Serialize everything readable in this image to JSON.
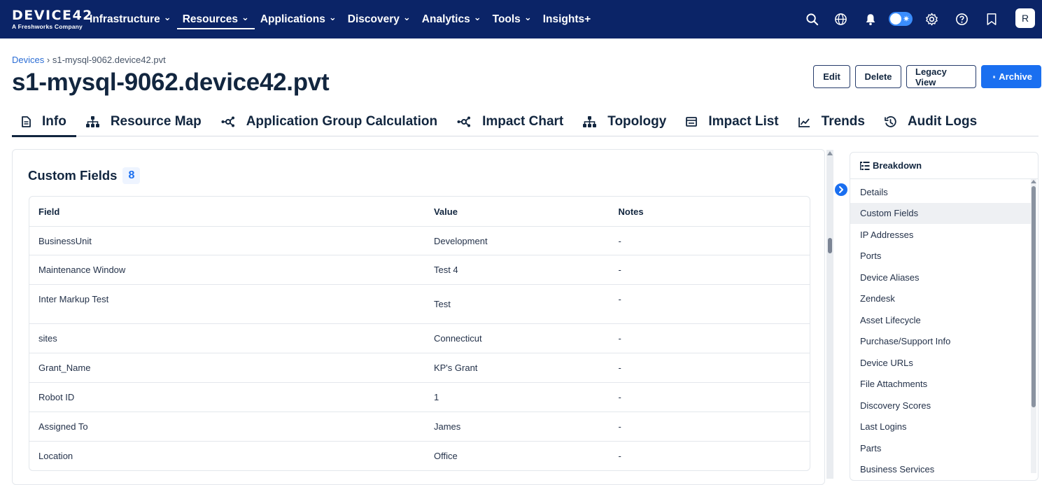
{
  "brand": {
    "name": "DEVICE42",
    "subtitle": "A Freshworks Company"
  },
  "nav": {
    "items": [
      {
        "label": "Infrastructure",
        "dropdown": true
      },
      {
        "label": "Resources",
        "dropdown": true,
        "active": true
      },
      {
        "label": "Applications",
        "dropdown": true
      },
      {
        "label": "Discovery",
        "dropdown": true
      },
      {
        "label": "Analytics",
        "dropdown": true
      },
      {
        "label": "Tools",
        "dropdown": true
      },
      {
        "label": "Insights+",
        "dropdown": false
      }
    ],
    "icons": [
      "search-icon",
      "globe-icon",
      "bell-icon",
      "theme-toggle",
      "gear-icon",
      "help-icon",
      "bookmark-icon"
    ],
    "avatar_initial": "R"
  },
  "breadcrumb": {
    "parent": "Devices",
    "separator": "›",
    "current": "s1-mysql-9062.device42.pvt"
  },
  "page_title": "s1-mysql-9062.device42.pvt",
  "actions": {
    "edit": "Edit",
    "delete": "Delete",
    "legacy": "Legacy View",
    "archive": "Archive"
  },
  "tabs": [
    {
      "label": "Info",
      "icon": "document-icon",
      "active": true
    },
    {
      "label": "Resource Map",
      "icon": "hierarchy-icon"
    },
    {
      "label": "Application Group Calculation",
      "icon": "network-icon"
    },
    {
      "label": "Impact Chart",
      "icon": "network-icon"
    },
    {
      "label": "Topology",
      "icon": "hierarchy-icon"
    },
    {
      "label": "Impact List",
      "icon": "list-box-icon"
    },
    {
      "label": "Trends",
      "icon": "trend-icon"
    },
    {
      "label": "Audit Logs",
      "icon": "history-icon"
    }
  ],
  "custom_fields": {
    "title": "Custom Fields",
    "count": "8",
    "columns": [
      "Field",
      "Value",
      "Notes"
    ],
    "rows": [
      {
        "field": "BusinessUnit",
        "value": "Development",
        "notes": "-"
      },
      {
        "field": "Maintenance Window",
        "value": "Test 4",
        "notes": "-"
      },
      {
        "field": "Inter Markup Test",
        "value": "Test",
        "notes": "-"
      },
      {
        "field": "sites",
        "value": "Connecticut",
        "notes": "-"
      },
      {
        "field": "Grant_Name",
        "value": "KP's Grant",
        "notes": "-"
      },
      {
        "field": "Robot ID",
        "value": "1",
        "notes": "-"
      },
      {
        "field": "Assigned To",
        "value": "James",
        "notes": "-"
      },
      {
        "field": "Location",
        "value": "Office",
        "notes": "-"
      }
    ]
  },
  "breakdown": {
    "title": "Breakdown",
    "items": [
      "Details",
      "Custom Fields",
      "IP Addresses",
      "Ports",
      "Device Aliases",
      "Zendesk",
      "Asset Lifecycle",
      "Purchase/Support Info",
      "Device URLs",
      "File Attachments",
      "Discovery Scores",
      "Last Logins",
      "Parts",
      "Business Services"
    ],
    "active": "Custom Fields"
  },
  "colors": {
    "nav_bg": "#0b2467",
    "primary": "#1a6ff0",
    "text": "#12263f"
  }
}
